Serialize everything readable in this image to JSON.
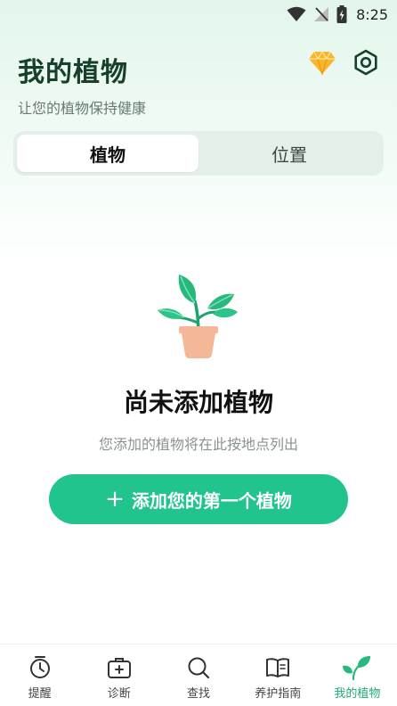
{
  "status_bar": {
    "time": "8:25",
    "icons": [
      "wifi-icon",
      "no-signal-icon",
      "battery-charging-icon"
    ]
  },
  "header": {
    "title": "我的植物",
    "subtitle": "让您的植物保持健康",
    "actions": [
      "gem-icon",
      "settings-icon"
    ]
  },
  "segment": {
    "tabs": [
      {
        "label": "植物",
        "selected": true
      },
      {
        "label": "位置",
        "selected": false
      }
    ]
  },
  "empty_state": {
    "icon": "potted-plant-icon",
    "title": "尚未添加植物",
    "description": "您添加的植物将在此按地点列出"
  },
  "add_button": {
    "icon": "plus",
    "label": "添加您的第一个植物"
  },
  "bottom_nav": {
    "items": [
      {
        "label": "提醒",
        "icon": "alarm-clock-icon"
      },
      {
        "label": "诊断",
        "icon": "medical-kit-icon"
      },
      {
        "label": "查找",
        "icon": "search-icon"
      },
      {
        "label": "养护指南",
        "icon": "book-icon"
      },
      {
        "label": "我的植物",
        "icon": "leaves-icon",
        "active": true
      }
    ]
  },
  "colors": {
    "accent": "#21c48c",
    "title": "#16402b",
    "leaf": "#26b87d",
    "pot": "#f4b898",
    "gem": "#f9b52c"
  }
}
